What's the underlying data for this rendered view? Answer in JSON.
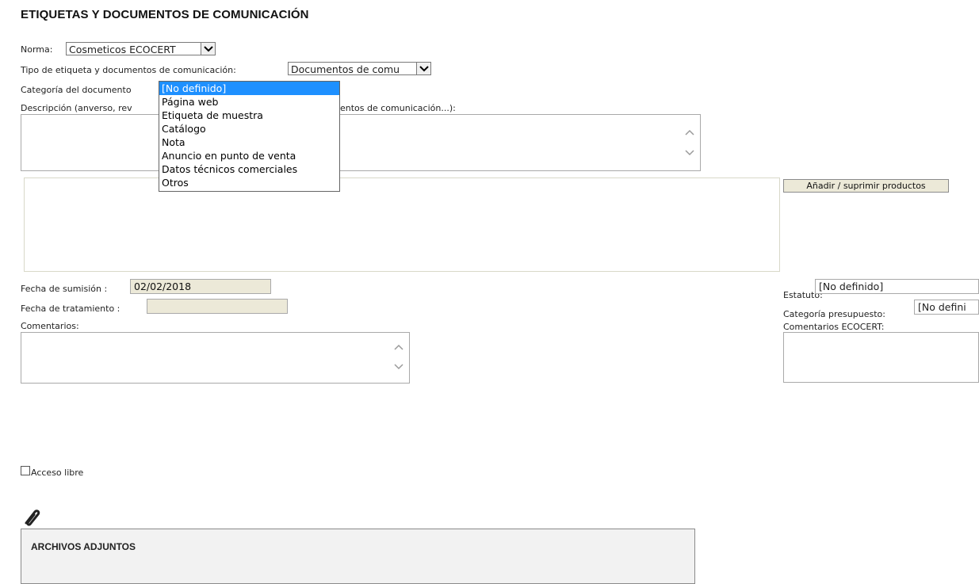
{
  "page": {
    "title": "ETIQUETAS Y DOCUMENTOS DE COMUNICACIÓN"
  },
  "norma": {
    "label": "Norma:",
    "value": "Cosmeticos ECOCERT"
  },
  "tipo": {
    "label": "Tipo de etiqueta y documentos de comunicación:",
    "value": "Documentos de comu"
  },
  "categoria": {
    "label": "Categoría del documento",
    "options": [
      "[No definido]",
      "Página web",
      "Etiqueta de muestra",
      "Catálogo",
      "Nota",
      "Anuncio en punto de venta",
      "Datos técnicos comerciales",
      "Otros"
    ],
    "selected_index": 0
  },
  "descripcion": {
    "label_start": "Descripción (anverso, rev",
    "label_end": "entos de comunicación...):"
  },
  "productos": {
    "button_label": "Añadir / suprimir productos"
  },
  "fechas": {
    "sumision_label": "Fecha de sumisión :",
    "sumision_value": "02/02/2018",
    "tratamiento_label": "Fecha de tratamiento :",
    "tratamiento_value": ""
  },
  "comentarios": {
    "label": "Comentarios:"
  },
  "estatuto": {
    "label": "Estatuto:",
    "value": "[No definido]"
  },
  "presupuesto": {
    "label": "Categoría presupuesto:",
    "value": "[No defini"
  },
  "comentarios_ecocert": {
    "label": "Comentarios ECOCERT:"
  },
  "acceso": {
    "label": "Acceso libre",
    "checked": false
  },
  "adjuntos": {
    "title": "ARCHIVOS ADJUNTOS",
    "icon": "paperclip-icon"
  },
  "colors": {
    "dropdown_highlight": "#1e90ff",
    "readonly_bg": "#ece9d8"
  }
}
